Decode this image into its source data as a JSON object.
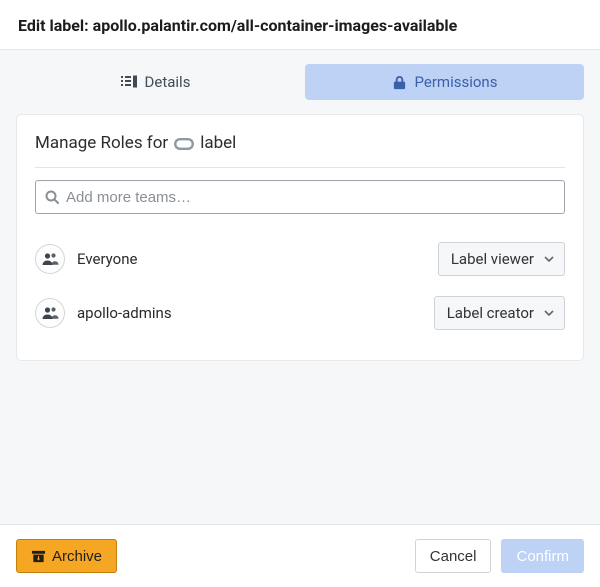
{
  "header": {
    "title": "Edit label: apollo.palantir.com/all-container-images-available"
  },
  "tabs": {
    "details": {
      "label": "Details"
    },
    "permissions": {
      "label": "Permissions"
    }
  },
  "panel": {
    "title_prefix": "Manage Roles for",
    "title_suffix": "label",
    "search_placeholder": "Add more teams…",
    "roles": [
      {
        "name": "Everyone",
        "role": "Label viewer"
      },
      {
        "name": "apollo-admins",
        "role": "Label creator"
      }
    ]
  },
  "footer": {
    "archive": "Archive",
    "cancel": "Cancel",
    "confirm": "Confirm"
  }
}
